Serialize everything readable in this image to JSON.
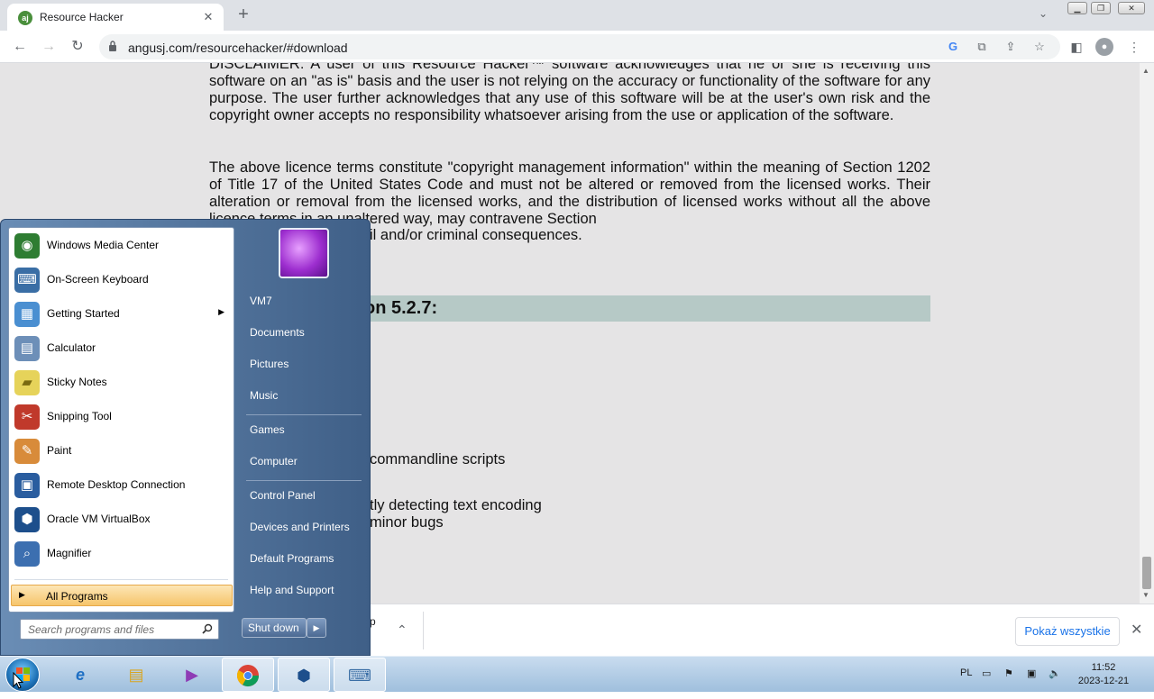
{
  "browser": {
    "tab_title": "Resource Hacker",
    "tab_favicon_text": "aj",
    "url": "angusj.com/resourcehacker/#download"
  },
  "page": {
    "disclaimer": "DISCLAIMER: A user of this Resource Hacker™ software acknowledges that he or she is receiving this software on an \"as is\" basis and the user is not relying on the accuracy or functionality of the software for any purpose. The user further acknowledges that any use of this software will be at the user's own risk and the copyright owner accepts no responsibility whatsoever arising from the use or application of the software.",
    "licence": "The above licence terms constitute \"copyright management information\" within the meaning of Section 1202 of Title 17 of the United States Code and must not be altered or removed from the licensed works. Their alteration or removal from the licensed works, and the distribution of licensed works without all the above licence terms in an unaltered way, may contravene Section",
    "licence_tail": "il and/or criminal consequences.",
    "version_heading_partial": "on 5.2.7:",
    "changelog": [
      "commandline scripts",
      "tly detecting text encoding",
      "minor bugs"
    ]
  },
  "downloads_bar": {
    "show_all": "Pokaż wszystkie",
    "partial_char": "p"
  },
  "start_menu": {
    "programs": [
      {
        "label": "Windows Media Center",
        "icon": "media-center-icon",
        "color": "#2e7d32"
      },
      {
        "label": "On-Screen Keyboard",
        "icon": "keyboard-icon",
        "color": "#3a6ea5"
      },
      {
        "label": "Getting Started",
        "icon": "getting-started-icon",
        "color": "#4a8fd1",
        "has_submenu": true
      },
      {
        "label": "Calculator",
        "icon": "calculator-icon",
        "color": "#6d8fb8"
      },
      {
        "label": "Sticky Notes",
        "icon": "sticky-notes-icon",
        "color": "#e6d35a"
      },
      {
        "label": "Snipping Tool",
        "icon": "scissors-icon",
        "color": "#c0392b"
      },
      {
        "label": "Paint",
        "icon": "paint-icon",
        "color": "#d88b3a"
      },
      {
        "label": "Remote Desktop Connection",
        "icon": "remote-desktop-icon",
        "color": "#2a5d9f"
      },
      {
        "label": "Oracle VM VirtualBox",
        "icon": "virtualbox-icon",
        "color": "#1d4f8c"
      },
      {
        "label": "Magnifier",
        "icon": "magnifier-icon",
        "color": "#3c6fb0"
      }
    ],
    "all_programs": "All Programs",
    "search_placeholder": "Search programs and files",
    "right_links": [
      "VM7",
      "Documents",
      "Pictures",
      "Music",
      "Games",
      "Computer",
      "Control Panel",
      "Devices and Printers",
      "Default Programs",
      "Help and Support"
    ],
    "shutdown": "Shut down"
  },
  "taskbar": {
    "lang": "PL",
    "time": "11:52",
    "date": "2023-12-21"
  }
}
